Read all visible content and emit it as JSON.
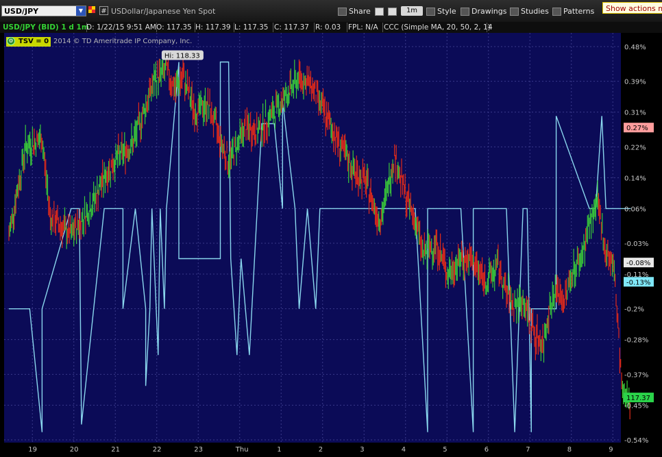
{
  "toolbar": {
    "symbol": "USD/JPY",
    "description": "USDollar/Japanese Yen Spot",
    "share": "Share",
    "timeframe": "1m",
    "style": "Style",
    "drawings": "Drawings",
    "studies": "Studies",
    "patterns": "Patterns",
    "show_actions": "Show actions me"
  },
  "infobar": {
    "title": "USD/JPY (BID) 1 d 1m",
    "date": "D: 1/22/15 9:51 AM",
    "open": "O: 117.35",
    "high": "H: 117.39",
    "low": "L: 117.35",
    "close": "C: 117.37",
    "range": "R: 0.03",
    "fpl": "FPL: N/A",
    "study": "CCC (Simple MA, 20, 50, 2, 1)",
    "count": "4"
  },
  "chart_overlay": {
    "tsv_label": "TSV = 0",
    "copyright": "2014 © TD Ameritrade IP Company, Inc.",
    "hi_label": "Hi: 118.33"
  },
  "colors": {
    "plot_bg": "#0b0b57",
    "grid": "#3a3a8a",
    "candle_up": "#39c839",
    "candle_down": "#e02a1a",
    "indicator": "#8ad7ee",
    "badge_current_price": "#2bd34a",
    "badge_pink": "#ff9d9d",
    "badge_cyan": "#7fe7f7"
  },
  "chart_data": {
    "type": "line",
    "title": "USD/JPY (BID) 1 d 1m",
    "x_ticks": [
      "19",
      "20",
      "21",
      "22",
      "23",
      "Thu",
      "1",
      "2",
      "3",
      "4",
      "5",
      "6",
      "7",
      "8",
      "9"
    ],
    "y_axis_labels": [
      "0.48%",
      "0.39%",
      "0.31%",
      "0.22%",
      "0.14%",
      "0.06%",
      "-0.03%",
      "-0.11%",
      "-0.2%",
      "-0.28%",
      "-0.37%",
      "-0.45%",
      "-0.54%"
    ],
    "y_range_percent": [
      -0.54,
      0.48
    ],
    "badges": [
      {
        "text": "0.27%",
        "y": 0.27,
        "kind": "pink"
      },
      {
        "text": "-0.08%",
        "y": -0.08,
        "kind": "gray"
      },
      {
        "text": "-0.13%",
        "y": -0.13,
        "kind": "cyan"
      },
      {
        "text": "117.37",
        "y": -0.43,
        "kind": "current"
      }
    ],
    "series": [
      {
        "name": "USD/JPY",
        "x": [
          0.0,
          0.4,
          0.8,
          1.0,
          1.5,
          2.0,
          2.3,
          2.6,
          3.0,
          3.5,
          3.8,
          4.0,
          4.2,
          4.5,
          4.8,
          5.0,
          5.3,
          5.7,
          6.0,
          6.4,
          6.8,
          7.0,
          7.3,
          7.6,
          8.0,
          8.3,
          8.6,
          8.9,
          9.0,
          9.3,
          9.6,
          9.8,
          10.0,
          10.3,
          10.6,
          10.9,
          11.2,
          11.5,
          11.8,
          12.0,
          12.2,
          12.4,
          12.7,
          12.9,
          13.0,
          13.2,
          13.4,
          13.6,
          13.8,
          14.0,
          14.2,
          14.4,
          14.6,
          14.8,
          15.0
        ],
        "y": [
          -0.01,
          0.22,
          0.24,
          0.04,
          -0.01,
          0.07,
          0.14,
          0.19,
          0.23,
          0.39,
          0.42,
          0.37,
          0.4,
          0.31,
          0.33,
          0.27,
          0.18,
          0.27,
          0.26,
          0.31,
          0.37,
          0.4,
          0.38,
          0.31,
          0.22,
          0.16,
          0.13,
          0.04,
          0.04,
          0.2,
          0.08,
          0.03,
          -0.06,
          -0.03,
          -0.11,
          -0.07,
          -0.08,
          -0.13,
          -0.09,
          -0.16,
          -0.19,
          -0.18,
          -0.27,
          -0.29,
          -0.21,
          -0.15,
          -0.18,
          -0.1,
          -0.07,
          0.02,
          0.07,
          -0.05,
          -0.1,
          -0.43,
          -0.43
        ]
      },
      {
        "name": "TSV",
        "x": [
          0.0,
          0.5,
          0.8,
          0.8,
          1.5,
          1.7,
          1.75,
          2.3,
          2.3,
          2.75,
          2.75,
          3.05,
          3.05,
          3.3,
          3.3,
          3.4,
          3.45,
          3.6,
          3.65,
          3.75,
          3.8,
          4.1,
          4.1,
          5.1,
          5.1,
          5.3,
          5.35,
          5.5,
          5.6,
          5.8,
          6.1,
          6.4,
          6.6,
          6.6,
          6.9,
          7.0,
          7.2,
          7.4,
          7.5,
          9.8,
          10.1,
          10.1,
          10.9,
          11.2,
          11.2,
          12.0,
          12.2,
          12.4,
          12.5,
          12.6,
          12.6,
          13.2,
          13.2,
          14.0,
          14.15,
          14.3,
          14.4,
          14.6,
          14.6,
          15.0
        ],
        "y": [
          -0.2,
          -0.2,
          -0.52,
          -0.2,
          0.06,
          0.06,
          -0.5,
          0.06,
          0.06,
          0.06,
          -0.2,
          0.06,
          0.06,
          -0.2,
          -0.4,
          -0.2,
          0.06,
          -0.32,
          0.06,
          -0.2,
          0.06,
          0.44,
          -0.07,
          -0.07,
          0.44,
          0.44,
          -0.07,
          -0.32,
          -0.07,
          -0.32,
          0.28,
          0.28,
          0.06,
          0.34,
          0.06,
          -0.2,
          0.06,
          -0.2,
          0.06,
          0.06,
          -0.52,
          0.06,
          0.06,
          -0.52,
          0.06,
          0.06,
          -0.52,
          0.06,
          0.06,
          -0.52,
          -0.2,
          -0.2,
          0.3,
          0.06,
          0.06,
          0.3,
          0.06,
          0.06,
          0.06,
          0.06
        ]
      }
    ]
  }
}
